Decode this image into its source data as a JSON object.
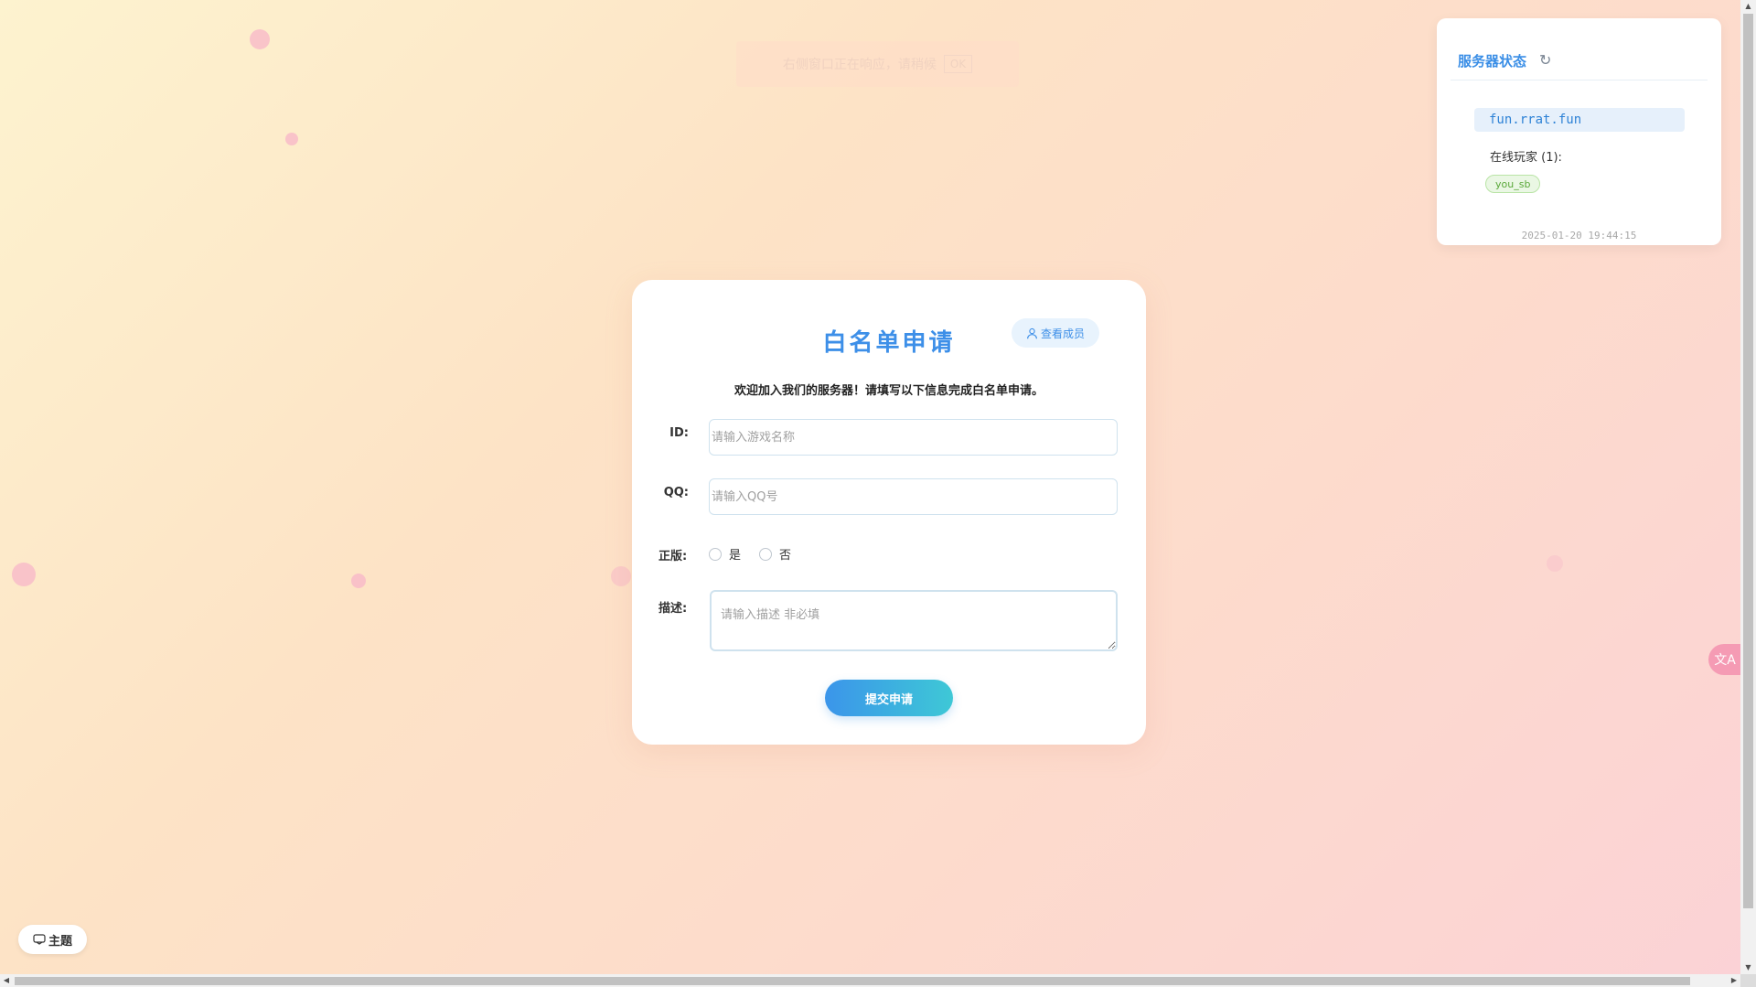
{
  "toast": {
    "text": "右侧窗口正在响应，请稍候",
    "button": "OK"
  },
  "status": {
    "title": "服务器状态",
    "server_address": "fun.rrat.fun",
    "players_label": "在线玩家 (1):",
    "players": [
      "you_sb"
    ],
    "timestamp": "2025-01-20 19:44:15"
  },
  "form": {
    "title": "白名单申请",
    "record_button": "查看成员",
    "welcome": "欢迎加入我们的服务器！请填写以下信息完成白名单申请。",
    "id_label": "ID:",
    "id_placeholder": "请输入游戏名称",
    "qq_label": "QQ:",
    "qq_placeholder": "请输入QQ号",
    "genuine_label": "正版:",
    "genuine_yes": "是",
    "genuine_no": "否",
    "desc_label": "描述:",
    "desc_placeholder": "请输入描述 非必填",
    "submit": "提交申请"
  },
  "theme_button": "主题",
  "translate_icon": "文A",
  "icons": {
    "refresh": "refresh-icon",
    "user": "user-icon",
    "theme": "palette-icon",
    "translate": "translate-icon"
  },
  "colors": {
    "accent": "#3d8fe8",
    "player_tag": "#5aa83a",
    "translate_bg": "#f59bb4"
  }
}
